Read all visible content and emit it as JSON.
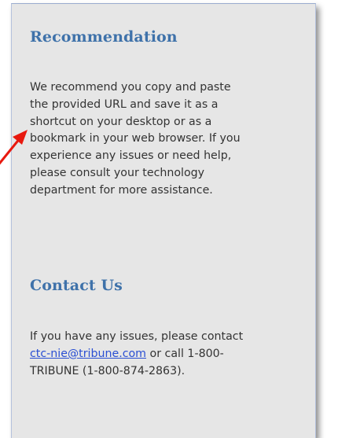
{
  "recommendation": {
    "title": "Recommendation",
    "lines": [
      "We recommend you copy and paste",
      "the provided URL and save it as a",
      "shortcut on your desktop or as a",
      "bookmark in your web browser. If you",
      "experience any issues or need help,",
      "please consult your technology",
      "department for more assistance."
    ]
  },
  "contact": {
    "title": "Contact Us",
    "line1": "If you have any issues, please contact",
    "email": "ctc-nie@tribune.com",
    "line2_after_email": " or call 1-800-",
    "line3": "TRIBUNE (1-800-874-2863)."
  },
  "colors": {
    "heading": "#3f72aa",
    "body_text": "#333333",
    "link": "#2a4fd3",
    "panel_bg": "#e6e6e6",
    "annotation_arrow": "#e8190f"
  },
  "icons": {
    "annotation": "red-arrow-icon"
  }
}
